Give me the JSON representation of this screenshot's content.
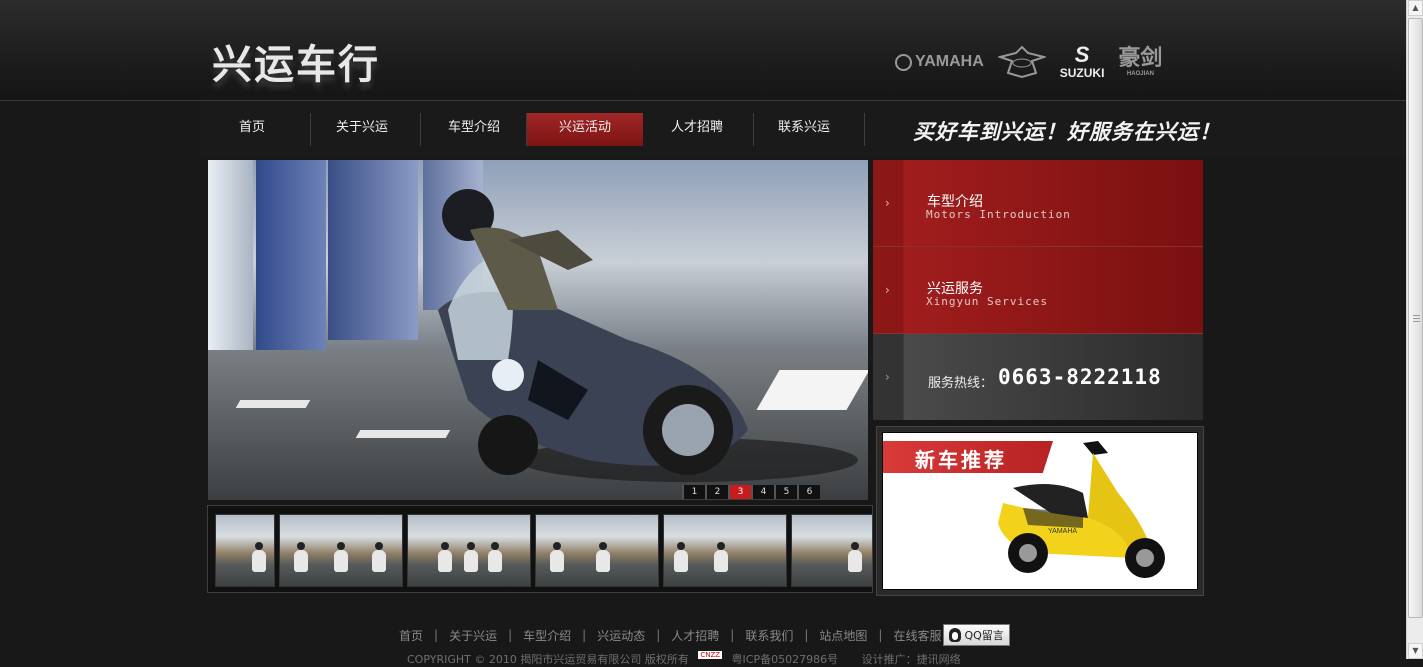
{
  "header": {
    "logo_text": "兴运车行",
    "brands": [
      "YAMAHA",
      "REGAL RAPTOR",
      "SUZUKI",
      "豪剑",
      "HAOJIAN"
    ]
  },
  "nav": {
    "items": [
      {
        "label": "首页",
        "active": false
      },
      {
        "label": "关于兴运",
        "active": false
      },
      {
        "label": "车型介绍",
        "active": false
      },
      {
        "label": "兴运活动",
        "active": true
      },
      {
        "label": "人才招聘",
        "active": false
      },
      {
        "label": "联系兴运",
        "active": false
      }
    ],
    "slogan": "买好车到兴运！好服务在兴运！"
  },
  "slideshow": {
    "pages": [
      "1",
      "2",
      "3",
      "4",
      "5",
      "6"
    ],
    "current_page": "3",
    "thumbnail_count": 6
  },
  "side": {
    "items": [
      {
        "title": "车型介绍",
        "subtitle": "Motors Introduction"
      },
      {
        "title": "兴运服务",
        "subtitle": "Xingyun Services"
      }
    ],
    "hotline_label": "服务热线：",
    "hotline_number": "0663-8222118",
    "arrow_glyph": "›"
  },
  "new_car": {
    "label": "新车推荐",
    "model_text": "YAMAHA"
  },
  "footer": {
    "links": [
      "首页",
      "关于兴运",
      "车型介绍",
      "兴运动态",
      "人才招聘",
      "联系我们",
      "站点地图",
      "在线客服"
    ],
    "qq_button": "QQ留言",
    "copyright": "COPYRIGHT © 2010 揭阳市兴运贸易有限公司  版权所有",
    "counter_badge": "CNZZ",
    "icp": "粤ICP备05027986号",
    "design": "设计推广：捷讯网络"
  },
  "colors": {
    "accent_red": "#8c1717",
    "background": "#181818"
  }
}
